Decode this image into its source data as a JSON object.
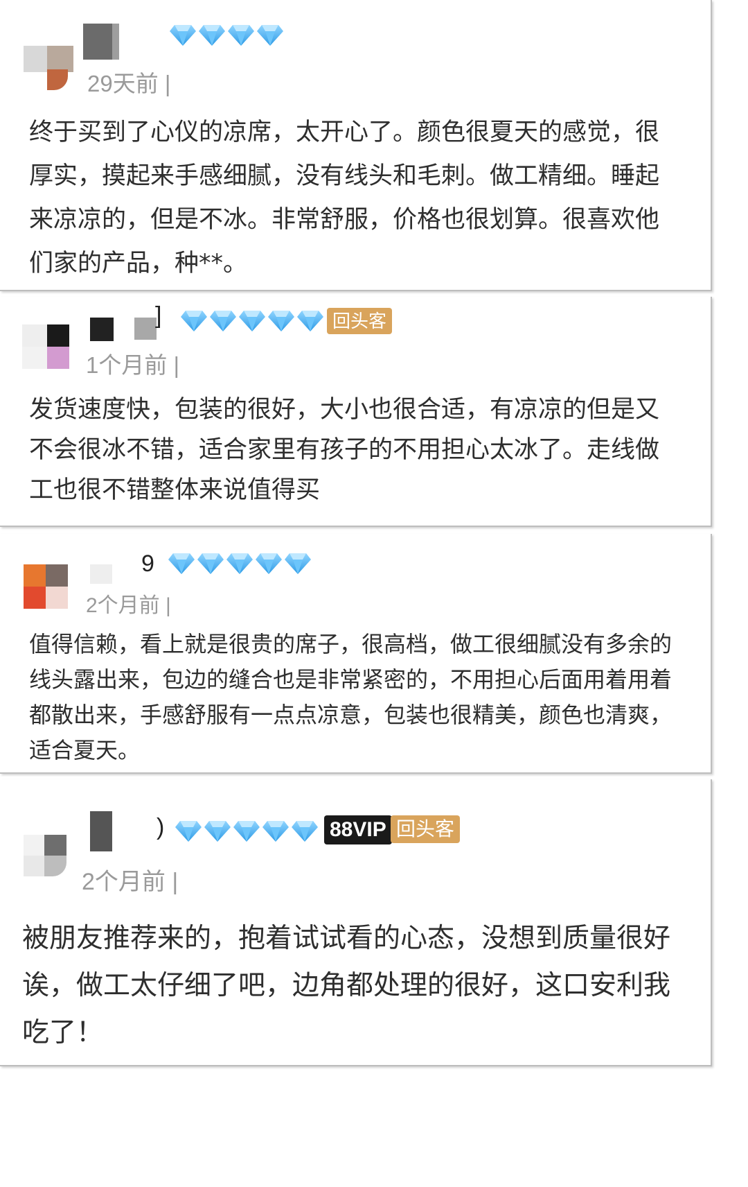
{
  "reviews": [
    {
      "time": "29天前 |",
      "diamonds": 4,
      "badges": [],
      "name_suffix": "",
      "text": "终于买到了心仪的凉席，太开心了。颜色很夏天的感觉，很厚实，摸起来手感细腻，没有线头和毛刺。做工精细。睡起来凉凉的，但是不冰。非常舒服，价格也很划算。很喜欢他们家的产品，种**。"
    },
    {
      "time": "1个月前 |",
      "diamonds": 5,
      "badges": [
        "回头客"
      ],
      "name_suffix": "]",
      "text": "发货速度快，包装的很好，大小也很合适，有凉凉的但是又不会很冰不错，适合家里有孩子的不用担心太冰了。走线做工也很不错整体来说值得买"
    },
    {
      "time": "2个月前 |",
      "diamonds": 5,
      "badges": [],
      "name_suffix": "9",
      "text": "值得信赖，看上就是很贵的席子，很高档，做工很细腻没有多余的线头露出来，包边的缝合也是非常紧密的，不用担心后面用着用着都散出来，手感舒服有一点点凉意，包装也很精美，颜色也清爽，适合夏天。"
    },
    {
      "time": "2个月前 |",
      "diamonds": 5,
      "badges": [
        "88VIP",
        "回头客"
      ],
      "name_suffix": ")",
      "text": "被朋友推荐来的，抱着试试看的心态，没想到质量很好诶，做工太仔细了吧，边角都处理的很好，这口安利我吃了！"
    }
  ],
  "icons": {
    "level": "diamond-icon"
  },
  "colors": {
    "diamond": "#4fb3f0",
    "badge_returning": "#d9a45c",
    "badge_vip": "#1a1a1a",
    "time": "#9a9a9a"
  }
}
